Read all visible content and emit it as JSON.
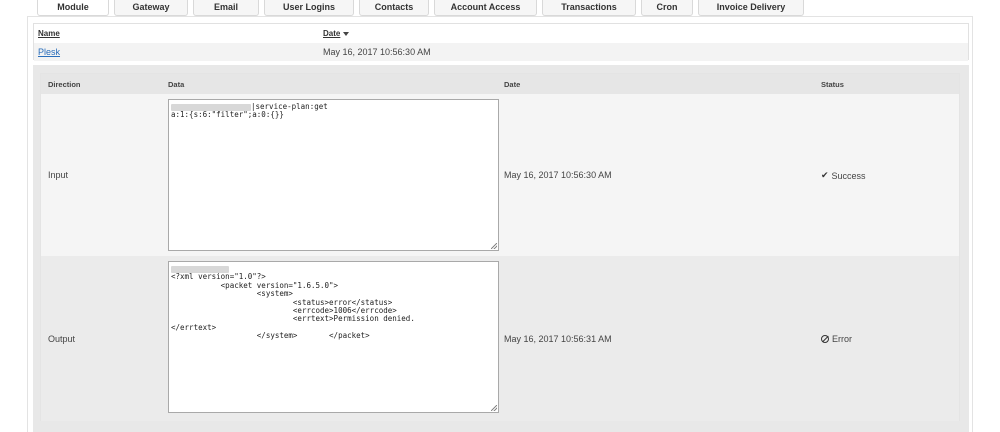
{
  "tabs": [
    {
      "label": "Module",
      "active": true
    },
    {
      "label": "Gateway",
      "active": false
    },
    {
      "label": "Email",
      "active": false
    },
    {
      "label": "User Logins",
      "active": false
    },
    {
      "label": "Contacts",
      "active": false
    },
    {
      "label": "Account Access",
      "active": false
    },
    {
      "label": "Transactions",
      "active": false
    },
    {
      "label": "Cron",
      "active": false
    },
    {
      "label": "Invoice Delivery",
      "active": false
    }
  ],
  "log_table": {
    "headers": {
      "name": "Name",
      "date": "Date"
    },
    "row": {
      "name": "Plesk",
      "date": "May 16, 2017 10:56:30 AM"
    }
  },
  "detail": {
    "headers": {
      "direction": "Direction",
      "data": "Data",
      "date": "Date",
      "status": "Status"
    },
    "rows": [
      {
        "direction": "Input",
        "data_lines": [
          "|service-plan:get",
          "a:1:{s:6:\"filter\";a:0:{}}"
        ],
        "date": "May 16, 2017 10:56:30 AM",
        "status": "Success",
        "status_icon": "check-icon"
      },
      {
        "direction": "Output",
        "data_lines": [
          "<?xml version=\"1.0\"?>",
          "           <packet version=\"1.6.5.0\">",
          "                   <system>",
          "                           <status>error</status>",
          "                           <errcode>1006</errcode>",
          "                           <errtext>Permission denied.",
          "</errtext>",
          "                   </system>       </packet>"
        ],
        "date": "May 16, 2017 10:56:31 AM",
        "status": "Error",
        "status_icon": "ban-icon"
      }
    ]
  }
}
